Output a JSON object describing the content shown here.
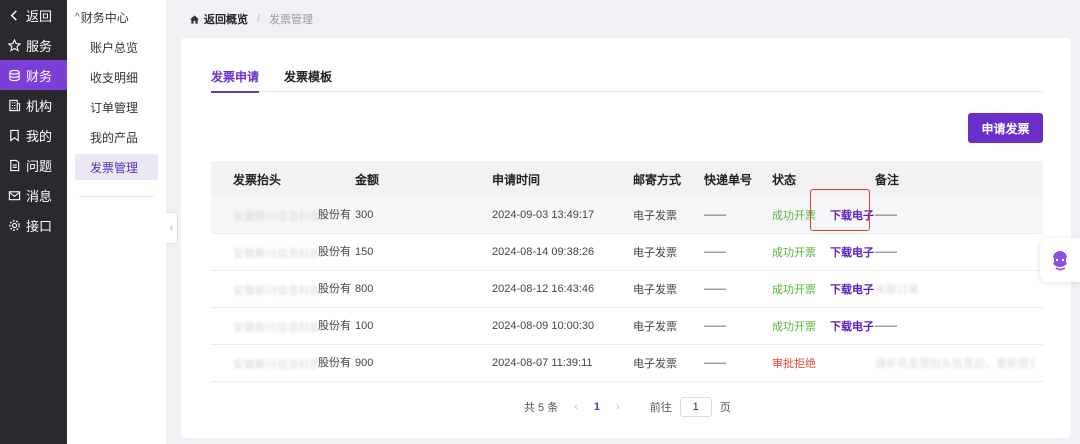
{
  "nav": {
    "items": [
      {
        "label": "返回",
        "icon": "chevron-left-icon"
      },
      {
        "label": "服务",
        "icon": "star-icon"
      },
      {
        "label": "财务",
        "icon": "database-icon"
      },
      {
        "label": "机构",
        "icon": "building-icon"
      },
      {
        "label": "我的",
        "icon": "bookmark-icon"
      },
      {
        "label": "问题",
        "icon": "document-icon"
      },
      {
        "label": "消息",
        "icon": "mail-icon"
      },
      {
        "label": "接口",
        "icon": "gear-icon"
      }
    ],
    "active_color": "#7b3fd8"
  },
  "submenu": {
    "title": "财务中心",
    "items": [
      "账户总览",
      "收支明细",
      "订单管理",
      "我的产品",
      "发票管理"
    ]
  },
  "breadcrumb": {
    "back": "返回概览",
    "separator": "/",
    "current": "发票管理"
  },
  "tabs": [
    "发票申请",
    "发票模板"
  ],
  "apply_button": "申请发票",
  "table": {
    "headers": [
      "发票抬头",
      "金额",
      "申请时间",
      "邮寄方式",
      "快递单号",
      "状态",
      "备注"
    ],
    "rows": [
      {
        "title": "安徽新兴信息科技股份有限公司",
        "company": "股份有",
        "amount": "300",
        "time": "2024-09-03 13:49:17",
        "mail": "电子发票",
        "tracking": "——",
        "status": "成功开票",
        "status_type": "success",
        "action": "下载电子",
        "note": "——"
      },
      {
        "title": "安徽新兴信息科技股份有限公司",
        "company": "股份有",
        "amount": "150",
        "time": "2024-08-14 09:38:26",
        "mail": "电子发票",
        "tracking": "——",
        "status": "成功开票",
        "status_type": "success",
        "action": "下载电子",
        "note": "——"
      },
      {
        "title": "安徽新兴信息科技股份有限公司",
        "company": "股份有",
        "amount": "800",
        "time": "2024-08-12 16:43:46",
        "mail": "电子发票",
        "tracking": "——",
        "status": "成功开票",
        "status_type": "success",
        "action": "下载电子",
        "note": "关联订单"
      },
      {
        "title": "安徽新兴信息科技股份有限公司",
        "company": "股份有",
        "amount": "100",
        "time": "2024-08-09 10:00:30",
        "mail": "电子发票",
        "tracking": "——",
        "status": "成功开票",
        "status_type": "success",
        "action": "下载电子",
        "note": "——"
      },
      {
        "title": "安徽新兴信息科技股份有限公司",
        "company": "股份有",
        "amount": "900",
        "time": "2024-08-07 11:39:11",
        "mail": "电子发票",
        "tracking": "——",
        "status": "审批拒绝",
        "status_type": "rejected",
        "action": "",
        "note": "请补充发票抬头信息后，重新提交"
      }
    ]
  },
  "pagination": {
    "total": "共 5 条",
    "page": "1",
    "goto_label": "前往",
    "goto_value": "1",
    "page_suffix": "页"
  },
  "colors": {
    "accent": "#6a2fc9",
    "success": "#57b43a",
    "danger": "#e2483c",
    "highlight_box": "#e23c2c"
  }
}
